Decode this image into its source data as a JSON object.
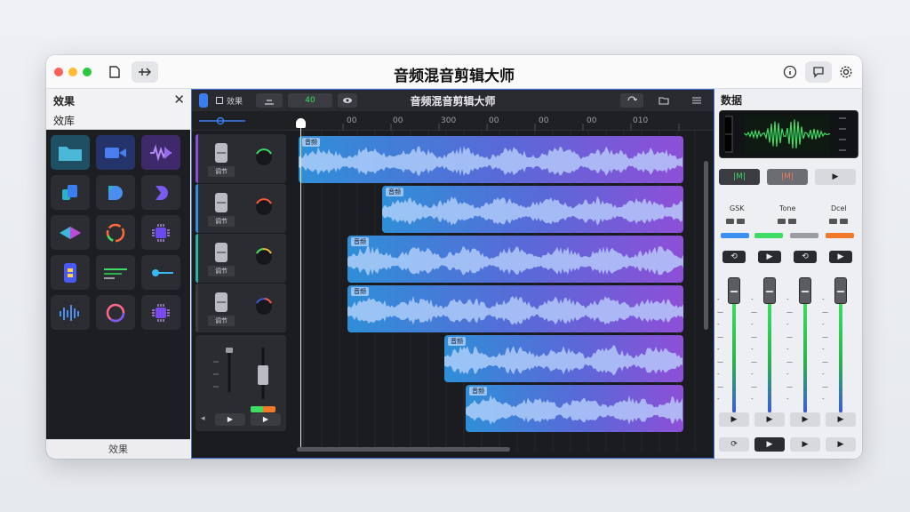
{
  "app": {
    "title": "音频混音剪辑大师"
  },
  "left_panel": {
    "title": "效果",
    "subtitle": "效库",
    "footer": "效果"
  },
  "center": {
    "toolbar_title": "音频混音剪辑大师",
    "toolbar_item_1": "效果",
    "toolbar_item_3": "40",
    "ruler_ticks": [
      "00",
      "00",
      "300",
      "00",
      "00",
      "00",
      "010"
    ]
  },
  "tracks": [
    {
      "label": "调节",
      "color": "#8a4fd8",
      "clip_label": "音频"
    },
    {
      "label": "调节",
      "color": "#2f8fd8",
      "clip_label": "音频"
    },
    {
      "label": "调节",
      "color": "#2ab3a0",
      "clip_label": "音频"
    },
    {
      "label": "调节",
      "color": "#3a3c42",
      "clip_label": "音频"
    }
  ],
  "extra_clips": [
    {
      "clip_label": "音频"
    },
    {
      "clip_label": "音频"
    }
  ],
  "right_panel": {
    "title": "数据",
    "btn_1": "|M|",
    "btn_2": "|M|",
    "btn_3": "▶",
    "labels": [
      "GSK",
      "Tone",
      "Dcel"
    ]
  },
  "colors": {
    "accent": "#3a6fd8",
    "clip_start": "#2f8fd8",
    "clip_end": "#8e4fd8",
    "led_blue": "#3b8ff0",
    "led_green": "#3ddc64",
    "led_gray": "#9a9ca2",
    "led_orange": "#f07a2a"
  },
  "icons": {
    "doc": "document-icon",
    "nav": "arrow-icon",
    "info": "info-icon",
    "chat": "chat-icon",
    "gear": "gear-icon"
  }
}
